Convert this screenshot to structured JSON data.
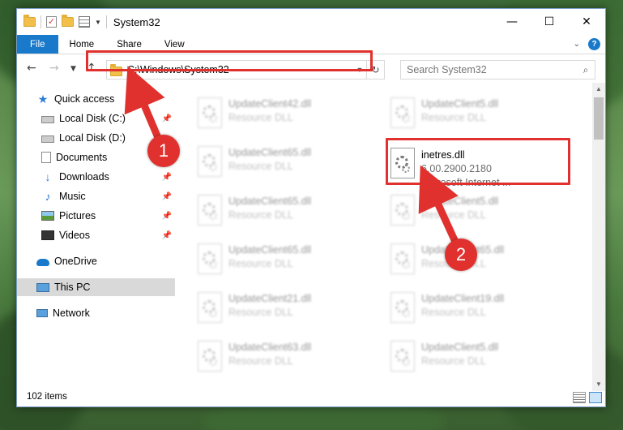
{
  "window": {
    "title": "System32"
  },
  "titlebar": {
    "minimize": "—",
    "maximize": "☐",
    "close": "✕"
  },
  "ribbon": {
    "tabs": [
      "File",
      "Home",
      "Share",
      "View"
    ]
  },
  "address": {
    "path": "C:\\Windows\\System32"
  },
  "search": {
    "placeholder": "Search System32"
  },
  "nav": {
    "items": [
      {
        "label": "Quick access",
        "icon": "star-icon",
        "pinned": false
      },
      {
        "label": "Local Disk (C:)",
        "icon": "disk-icon",
        "pinned": true
      },
      {
        "label": "Local Disk (D:)",
        "icon": "disk-icon",
        "pinned": true
      },
      {
        "label": "Documents",
        "icon": "documents-icon",
        "pinned": true
      },
      {
        "label": "Downloads",
        "icon": "download-icon",
        "pinned": true
      },
      {
        "label": "Music",
        "icon": "music-icon",
        "pinned": true
      },
      {
        "label": "Pictures",
        "icon": "pictures-icon",
        "pinned": true
      },
      {
        "label": "Videos",
        "icon": "videos-icon",
        "pinned": true
      },
      {
        "label": "OneDrive",
        "icon": "onedrive-icon",
        "pinned": false
      },
      {
        "label": "This PC",
        "icon": "this-pc-icon",
        "pinned": false,
        "active": true
      },
      {
        "label": "Network",
        "icon": "network-icon",
        "pinned": false
      }
    ]
  },
  "files": {
    "left": [
      {
        "name": "UpdateClient42.dll",
        "type": "Resource DLL"
      },
      {
        "name": "UpdateClient65.dll",
        "type": "Resource DLL"
      },
      {
        "name": "UpdateClient65.dll",
        "type": "Resource DLL"
      },
      {
        "name": "UpdateClient65.dll",
        "type": "Resource DLL"
      },
      {
        "name": "UpdateClient21.dll",
        "type": "Resource DLL"
      },
      {
        "name": "UpdateClient63.dll",
        "type": "Resource DLL"
      }
    ],
    "right": [
      {
        "name": "UpdateClient5.dll",
        "type": "Resource DLL"
      },
      {
        "name": "inetres.dll",
        "version": "6.00.2900.2180",
        "company": "Microsoft Internet ..."
      },
      {
        "name": "UpdateClient5.dll",
        "type": "Resource DLL"
      },
      {
        "name": "UpdateClient65.dll",
        "type": "Resource DLL"
      },
      {
        "name": "UpdateClient19.dll",
        "type": "Resource DLL"
      },
      {
        "name": "UpdateClient5.dll",
        "type": "Resource DLL"
      }
    ]
  },
  "status": {
    "item_count": "102 items"
  },
  "callouts": {
    "step1": "1",
    "step2": "2"
  },
  "colors": {
    "accent": "#1979ca",
    "highlight": "#e0312e",
    "nav_active": "#d9d9d9"
  }
}
